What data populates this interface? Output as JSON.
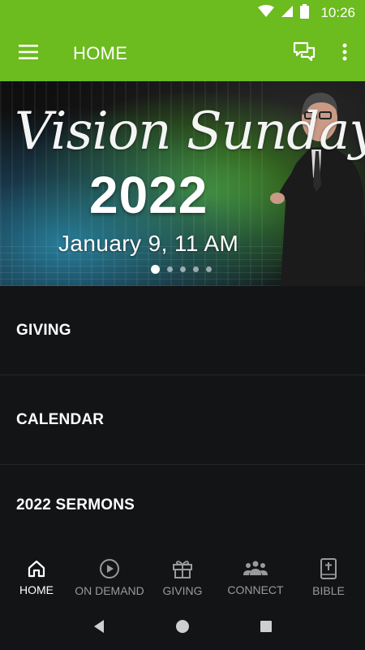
{
  "status_bar": {
    "time": "10:26",
    "icons": [
      "wifi-icon",
      "cell-signal-icon",
      "battery-icon"
    ]
  },
  "app_bar": {
    "title": "HOME",
    "menu_icon": "hamburger-menu-icon",
    "chat_icon": "chat-bubbles-icon",
    "overflow_icon": "more-vert-icon",
    "color": "#6cbb1f"
  },
  "banner": {
    "script_title": "Vision Sunday",
    "year": "2022",
    "date": "January 9, 11 AM",
    "slide_count": 5,
    "active_slide": 1
  },
  "list": {
    "items": [
      {
        "label": "GIVING"
      },
      {
        "label": "CALENDAR"
      },
      {
        "label": "2022 SERMONS"
      }
    ]
  },
  "bottom_nav": {
    "items": [
      {
        "label": "HOME",
        "icon": "home-icon",
        "active": true
      },
      {
        "label": "ON DEMAND",
        "icon": "play-circle-icon",
        "active": false
      },
      {
        "label": "GIVING",
        "icon": "gift-icon",
        "active": false
      },
      {
        "label": "CONNECT",
        "icon": "group-icon",
        "active": false
      },
      {
        "label": "BIBLE",
        "icon": "bible-icon",
        "active": false
      }
    ]
  },
  "system_nav": {
    "icons": [
      "back-icon",
      "home-circle-icon",
      "recents-icon"
    ]
  }
}
